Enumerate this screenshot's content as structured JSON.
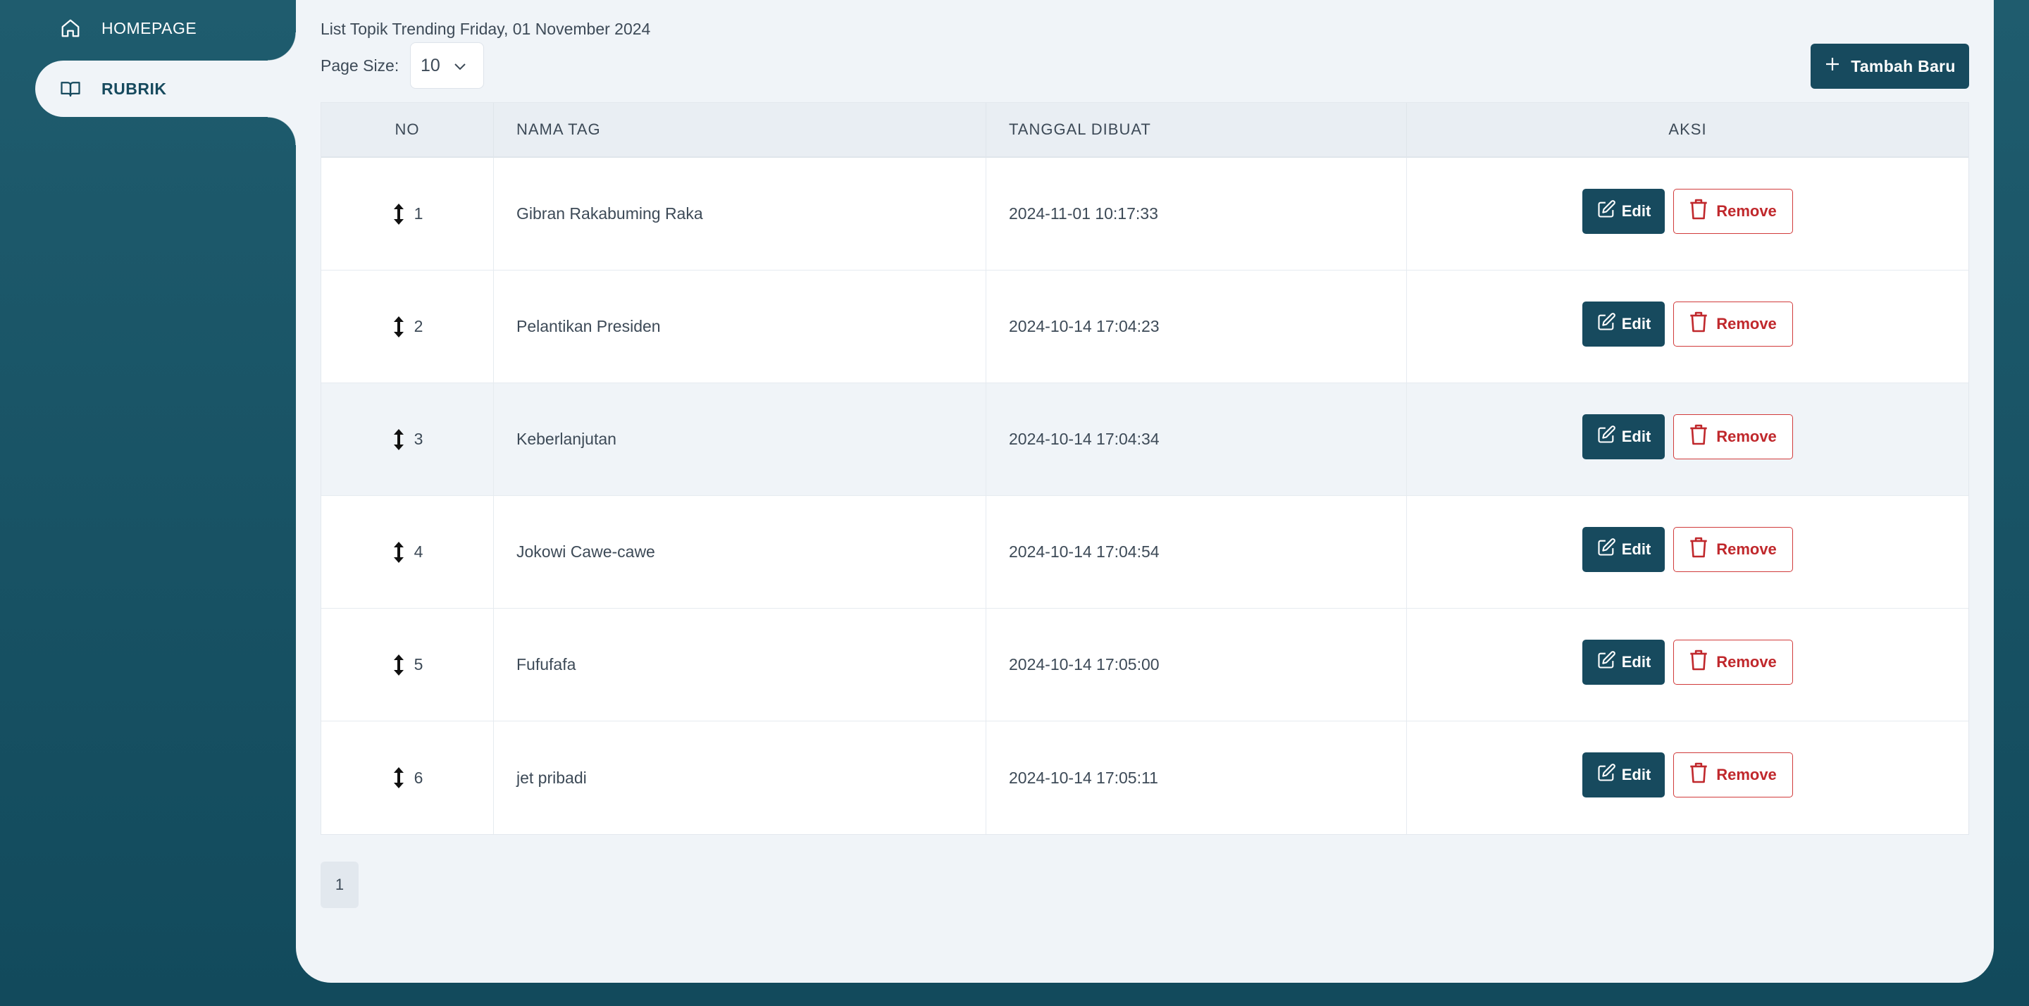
{
  "sidebar": {
    "items": [
      {
        "label": "HOMEPAGE",
        "icon": "home-icon"
      },
      {
        "label": "RUBRIK",
        "icon": "book-icon",
        "active": true
      }
    ]
  },
  "header": {
    "title": "List Topik Trending Friday, 01 November 2024",
    "page_size_label": "Page Size:",
    "page_size_value": "10",
    "add_label": "Tambah Baru"
  },
  "table": {
    "columns": [
      "NO",
      "NAMA TAG",
      "TANGGAL DIBUAT",
      "AKSI"
    ],
    "rows": [
      {
        "no": "1",
        "name": "Gibran Rakabuming Raka",
        "date": "2024-11-01 10:17:33"
      },
      {
        "no": "2",
        "name": "Pelantikan Presiden",
        "date": "2024-10-14 17:04:23"
      },
      {
        "no": "3",
        "name": "Keberlanjutan",
        "date": "2024-10-14 17:04:34"
      },
      {
        "no": "4",
        "name": "Jokowi Cawe-cawe",
        "date": "2024-10-14 17:04:54"
      },
      {
        "no": "5",
        "name": "Fufufafa",
        "date": "2024-10-14 17:05:00"
      },
      {
        "no": "6",
        "name": "jet pribadi",
        "date": "2024-10-14 17:05:11"
      }
    ],
    "edit_label": "Edit",
    "remove_label": "Remove"
  },
  "pagination": {
    "current": "1"
  },
  "colors": {
    "primary": "#174a5e",
    "danger": "#c0282c",
    "background": "#f0f4f8"
  }
}
